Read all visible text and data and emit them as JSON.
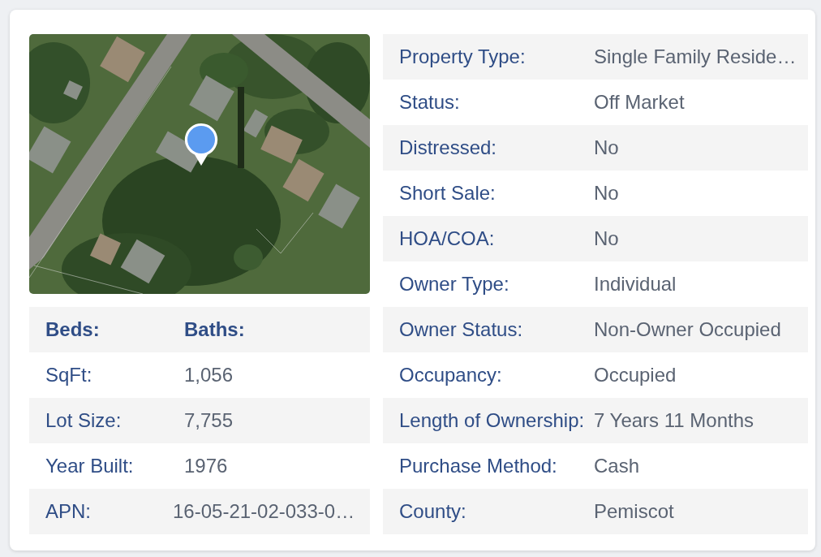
{
  "left_table": {
    "header": {
      "beds_label": "Beds:",
      "baths_label": "Baths:"
    },
    "rows": [
      {
        "label": "SqFt:",
        "value": "1,056"
      },
      {
        "label": "Lot Size:",
        "value": "7,755"
      },
      {
        "label": "Year Built:",
        "value": "1976"
      },
      {
        "label": "APN:",
        "value": "16-05-21-02-033-0…"
      }
    ]
  },
  "right_table": {
    "rows": [
      {
        "label": "Property Type:",
        "value": "Single Family Reside…"
      },
      {
        "label": "Status:",
        "value": "Off Market"
      },
      {
        "label": "Distressed:",
        "value": "No"
      },
      {
        "label": "Short Sale:",
        "value": "No"
      },
      {
        "label": "HOA/COA:",
        "value": "No"
      },
      {
        "label": "Owner Type:",
        "value": "Individual"
      },
      {
        "label": "Owner Status:",
        "value": "Non-Owner Occupied"
      },
      {
        "label": "Occupancy:",
        "value": "Occupied"
      },
      {
        "label": "Length of Ownership:",
        "value": "7 Years 11 Months"
      },
      {
        "label": "Purchase Method:",
        "value": "Cash"
      },
      {
        "label": "County:",
        "value": "Pemiscot"
      }
    ]
  }
}
